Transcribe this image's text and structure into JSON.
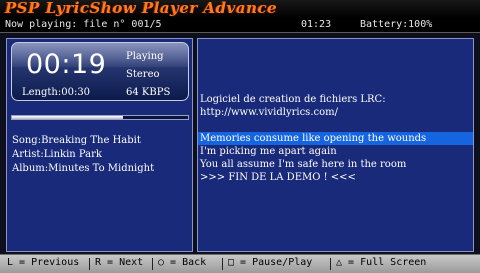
{
  "app": {
    "title": "PSP LyricShow Player Advance"
  },
  "status": {
    "now_playing": "Now playing: file n° 001/5",
    "clock": "01:23",
    "battery": "Battery:100%"
  },
  "player": {
    "elapsed": "00:19",
    "state": "Playing",
    "channels": "Stereo",
    "length": "Length:00:30",
    "bitrate": "64 KBPS",
    "progress": 0.63
  },
  "track": {
    "song": "Song:Breaking The Habit",
    "artist": "Artist:Linkin Park",
    "album": "Album:Minutes To Midnight"
  },
  "lyrics": {
    "lines": [
      "Logiciel de creation de fichiers LRC:",
      "http://www.vividlyrics.com/",
      "",
      "Memories consume like opening the wounds",
      "I'm picking me apart again",
      "You all assume I'm safe here in the room",
      ">>> FIN DE LA DEMO ! <<<"
    ],
    "current_index": 3
  },
  "controls": {
    "previous": "L = Previous",
    "next": "R = Next",
    "back": "○ = Back",
    "pause_play": "□ = Pause/Play",
    "full_screen": "△ = Full Screen"
  },
  "colors": {
    "title_orange": "#ff7a1c",
    "panel_blue": "#1a2a7a",
    "highlight_blue": "#1565e0"
  }
}
